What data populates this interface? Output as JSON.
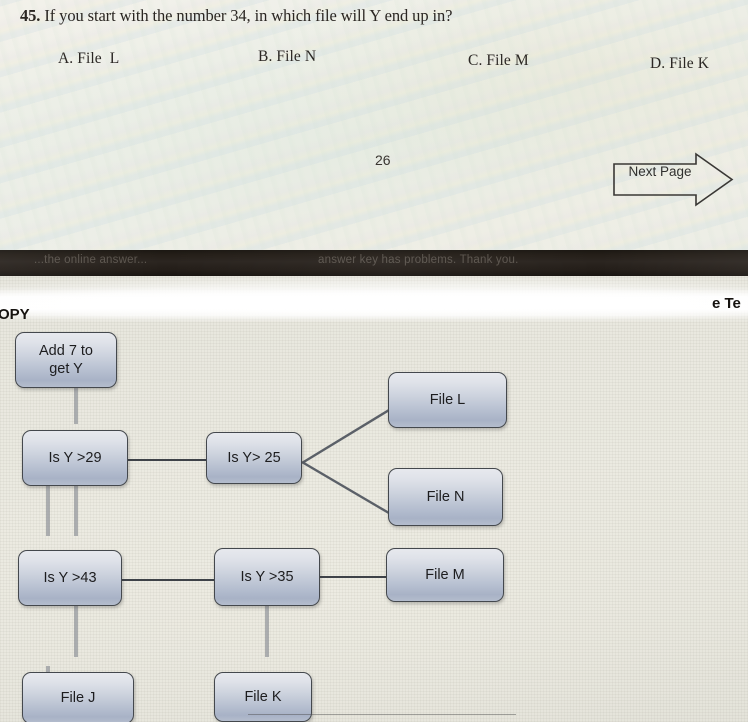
{
  "question": {
    "number": "45.",
    "text": " If you start with the number 34, in which file will Y end up in?",
    "options": [
      {
        "key": "A",
        "label": "A. File  L"
      },
      {
        "key": "B",
        "label": "B. File N"
      },
      {
        "key": "C",
        "label": "C. File M"
      },
      {
        "key": "D",
        "label": "D. File K"
      }
    ],
    "page_number": "26",
    "next_page_label": "Next Page"
  },
  "seam_band": {
    "text_left": "...the online answer...",
    "text_right": "answer key has problems.  Thank you."
  },
  "edge_labels": {
    "left": "OPY",
    "right": "e Te"
  },
  "flowchart": {
    "nodes": [
      {
        "id": "add7",
        "label": "Add 7 to\nget Y"
      },
      {
        "id": "y29",
        "label": "Is Y >29"
      },
      {
        "id": "y25",
        "label": "Is Y> 25"
      },
      {
        "id": "fileL",
        "label": "File L"
      },
      {
        "id": "fileN",
        "label": "File N"
      },
      {
        "id": "y43",
        "label": "Is Y >43"
      },
      {
        "id": "y35",
        "label": "Is Y >35"
      },
      {
        "id": "fileM",
        "label": "File M"
      },
      {
        "id": "fileJ",
        "label": "File J"
      },
      {
        "id": "fileK",
        "label": "File K"
      }
    ]
  },
  "colors": {
    "node_border": "#44484d",
    "node_text": "#1d1d1f",
    "connector": "#3e4248",
    "band": "#241e18",
    "top_paper": "#f0efe8",
    "bottom_paper": "#e9e8df"
  }
}
